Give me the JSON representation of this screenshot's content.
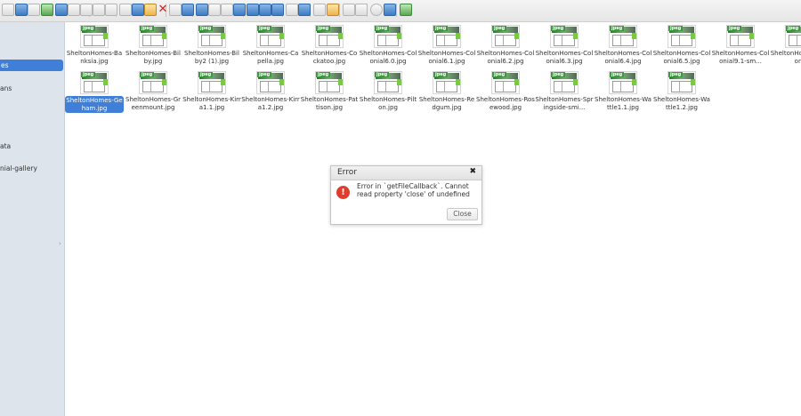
{
  "toolbar": {
    "buttons": [
      {
        "icon": "up-folder-icon"
      },
      {
        "icon": "reload-icon"
      },
      {
        "icon": "open-icon"
      },
      {
        "icon": "download-icon"
      },
      {
        "icon": "copy-icon"
      },
      {
        "icon": "cut-icon"
      },
      {
        "icon": "paste-icon"
      },
      {
        "icon": "undo-icon"
      },
      {
        "icon": "redo-icon"
      },
      {
        "icon": "duplicate-icon"
      },
      {
        "icon": "scissors-icon"
      },
      {
        "icon": "paste-clipboard-icon"
      },
      {
        "icon": "delete-icon"
      },
      {
        "icon": "empty-trash-icon"
      },
      {
        "icon": "rename-icon"
      },
      {
        "icon": "info-icon"
      },
      {
        "icon": "preview-icon"
      },
      {
        "icon": "edit-icon"
      },
      {
        "icon": "archive-icon"
      },
      {
        "icon": "grid-view-icon"
      },
      {
        "icon": "list-view-icon"
      },
      {
        "icon": "link-icon"
      },
      {
        "icon": "view-icon"
      },
      {
        "icon": "details-icon"
      },
      {
        "icon": "image-icon"
      },
      {
        "icon": "resize-icon"
      },
      {
        "icon": "sort-icon"
      },
      {
        "icon": "filter-icon"
      },
      {
        "icon": "settings-icon"
      },
      {
        "icon": "help-icon"
      },
      {
        "icon": "fullscreen-icon"
      }
    ]
  },
  "sidebar": {
    "items": [
      {
        "label": "es",
        "active": true
      },
      {
        "label": "ans"
      },
      {
        "label": "ata"
      },
      {
        "label": "nial-gallery"
      }
    ]
  },
  "files": [
    {
      "name": "SheltonHomes-Banksia.jpg"
    },
    {
      "name": "SheltonHomes-Bilby.jpg"
    },
    {
      "name": "SheltonHomes-Bilby2 (1).jpg"
    },
    {
      "name": "SheltonHomes-Capella.jpg"
    },
    {
      "name": "SheltonHomes-Cockatoo.jpg"
    },
    {
      "name": "SheltonHomes-Colonial6.0.jpg"
    },
    {
      "name": "SheltonHomes-Colonial6.1.jpg"
    },
    {
      "name": "SheltonHomes-Colonial6.2.jpg"
    },
    {
      "name": "SheltonHomes-Colonial6.3.jpg"
    },
    {
      "name": "SheltonHomes-Colonial6.4.jpg"
    },
    {
      "name": "SheltonHomes-Colonial6.5.jpg"
    },
    {
      "name": "SheltonHomes-Colonial9.1-sm..."
    },
    {
      "name": "SheltonHomes-Coloni"
    },
    {
      "name": "SheltonHomes-Geham.jpg",
      "selected": true
    },
    {
      "name": "SheltonHomes-Greenmount.jpg"
    },
    {
      "name": "SheltonHomes-Kirra1.1.jpg"
    },
    {
      "name": "SheltonHomes-Kirra1.2.jpg"
    },
    {
      "name": "SheltonHomes-Pattison.jpg"
    },
    {
      "name": "SheltonHomes-Pilton.jpg"
    },
    {
      "name": "SheltonHomes-Redgum.jpg"
    },
    {
      "name": "SheltonHomes-Rosewood.jpg"
    },
    {
      "name": "SheltonHomes-Springside-smi..."
    },
    {
      "name": "SheltonHomes-Wattle1.1.jpg"
    },
    {
      "name": "SheltonHomes-Wattle1.2.jpg"
    }
  ],
  "thumb_tag": "jpeg",
  "dialog": {
    "title": "Error",
    "close_glyph": "✖",
    "icon_glyph": "!",
    "message": "Error in `getFileCallback`. Cannot read property 'close' of undefined",
    "button": "Close"
  },
  "colors": {
    "accent": "#3f7fd8",
    "error": "#e23c2c"
  }
}
